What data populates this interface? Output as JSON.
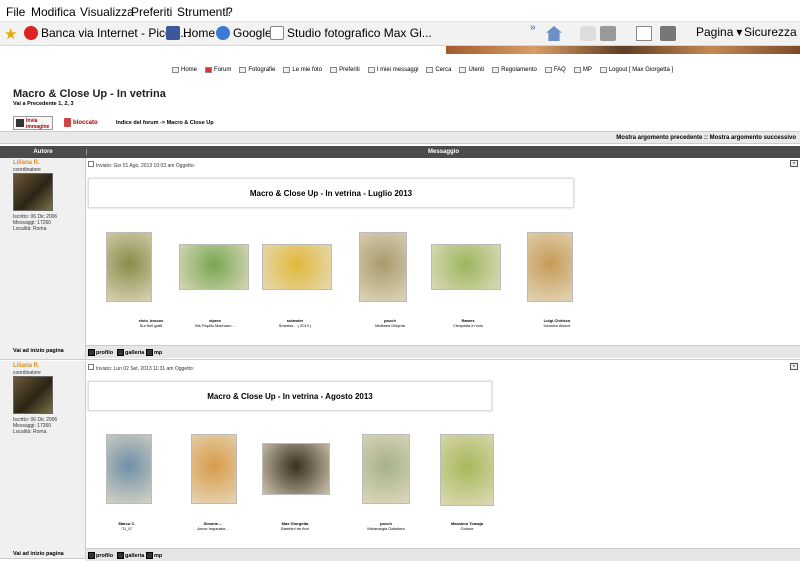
{
  "menu": [
    "File",
    "Modifica",
    "Visualizza",
    "Preferiti",
    "Strumenti",
    "?"
  ],
  "favorites": [
    {
      "label": "Banca via Internet - Piccol...",
      "color": "#d22"
    },
    {
      "label": "Home",
      "color": "#3b5998"
    },
    {
      "label": "Google",
      "color": "#3a7bd5"
    },
    {
      "label": "Studio fotografico Max Gi...",
      "color": "#ffffff"
    }
  ],
  "toolbar": {
    "more": "»",
    "pagina": "Pagina",
    "sicurezza": "Sicurezza"
  },
  "topnav": [
    "Home",
    "Forum",
    "Fotografie",
    "Le mie foto",
    "Preferiti",
    "I miei messaggi",
    "Cerca",
    "Utenti",
    "Regolamento",
    "FAQ",
    "MP",
    "Logout [ Max Giorgetta ]"
  ],
  "page": {
    "title": "Macro & Close Up - In vetrina",
    "pages": "Vai a Precedente  1, 2, 3",
    "btn_new": "Invia immagine",
    "btn_locked": "bloccato",
    "breadcrumb": "Indice del forum -> Macro & Close Up",
    "prevnext": "Mostra argomento precedente :: Mostra argomento successivo",
    "col_author": "Autore",
    "col_message": "Messaggio"
  },
  "posts": [
    {
      "author": "Liliana R.",
      "role": "coordinatore",
      "info": "Iscritto: 06 Dic 2006\nMessaggi: 17260\nLocalità: Roma",
      "meta": "Inviato: Gio 01 Ago, 2013 10:03 am    Oggetto:",
      "title": "Macro & Close Up - In vetrina - Luglio 2013",
      "top": "Vai ad inizio pagina",
      "actions": [
        "profilo",
        "galleria",
        "mp"
      ],
      "thumbs": [
        {
          "name": "elvio_brocov",
          "cap": "Sui fiori gialli",
          "color": "#8b8b4a"
        },
        {
          "name": "vipero",
          "cap": "Bis Papilio Machaon...",
          "color": "#79a653"
        },
        {
          "name": "sciander",
          "cap": "Smerlss... ( 2013 )",
          "color": "#e0b83a"
        },
        {
          "name": "pocch",
          "cap": "Melitaea Didyma",
          "color": "#a89a6e"
        },
        {
          "name": "Ramex",
          "cap": "Cleopatra in volo",
          "color": "#9bb65e"
        },
        {
          "name": "Luigi Chirisco",
          "cap": "Incontro Atroce",
          "color": "#c69a58"
        }
      ]
    },
    {
      "author": "Liliana R.",
      "role": "coordinatore",
      "info": "Iscritto: 06 Dic 2006\nMessaggi: 17260\nLocalità: Roma",
      "meta": "Inviato: Lun 02 Set, 2013 11:31 am    Oggetto:",
      "title": "Macro & Close Up - In vetrina - Agosto 2013",
      "top": "Vai ad inizio pagina",
      "actions": [
        "profilo",
        "galleria",
        "mp"
      ],
      "thumbs": [
        {
          "name": "Marco C.",
          "cap": "\"Ü_Ü\"",
          "color": "#6f8fa8"
        },
        {
          "name": "Simone....",
          "cap": "Ancor imparator...",
          "color": "#d89b4a"
        },
        {
          "name": "Max Giorgetta",
          "cap": "Bambini tre fiori",
          "color": "#3a2e1e"
        },
        {
          "name": "pocch",
          "cap": "Melanargia Galathea",
          "color": "#a6b08a"
        },
        {
          "name": "Massimo Tomaja",
          "cap": "Golone",
          "color": "#a7b85a"
        }
      ]
    }
  ]
}
